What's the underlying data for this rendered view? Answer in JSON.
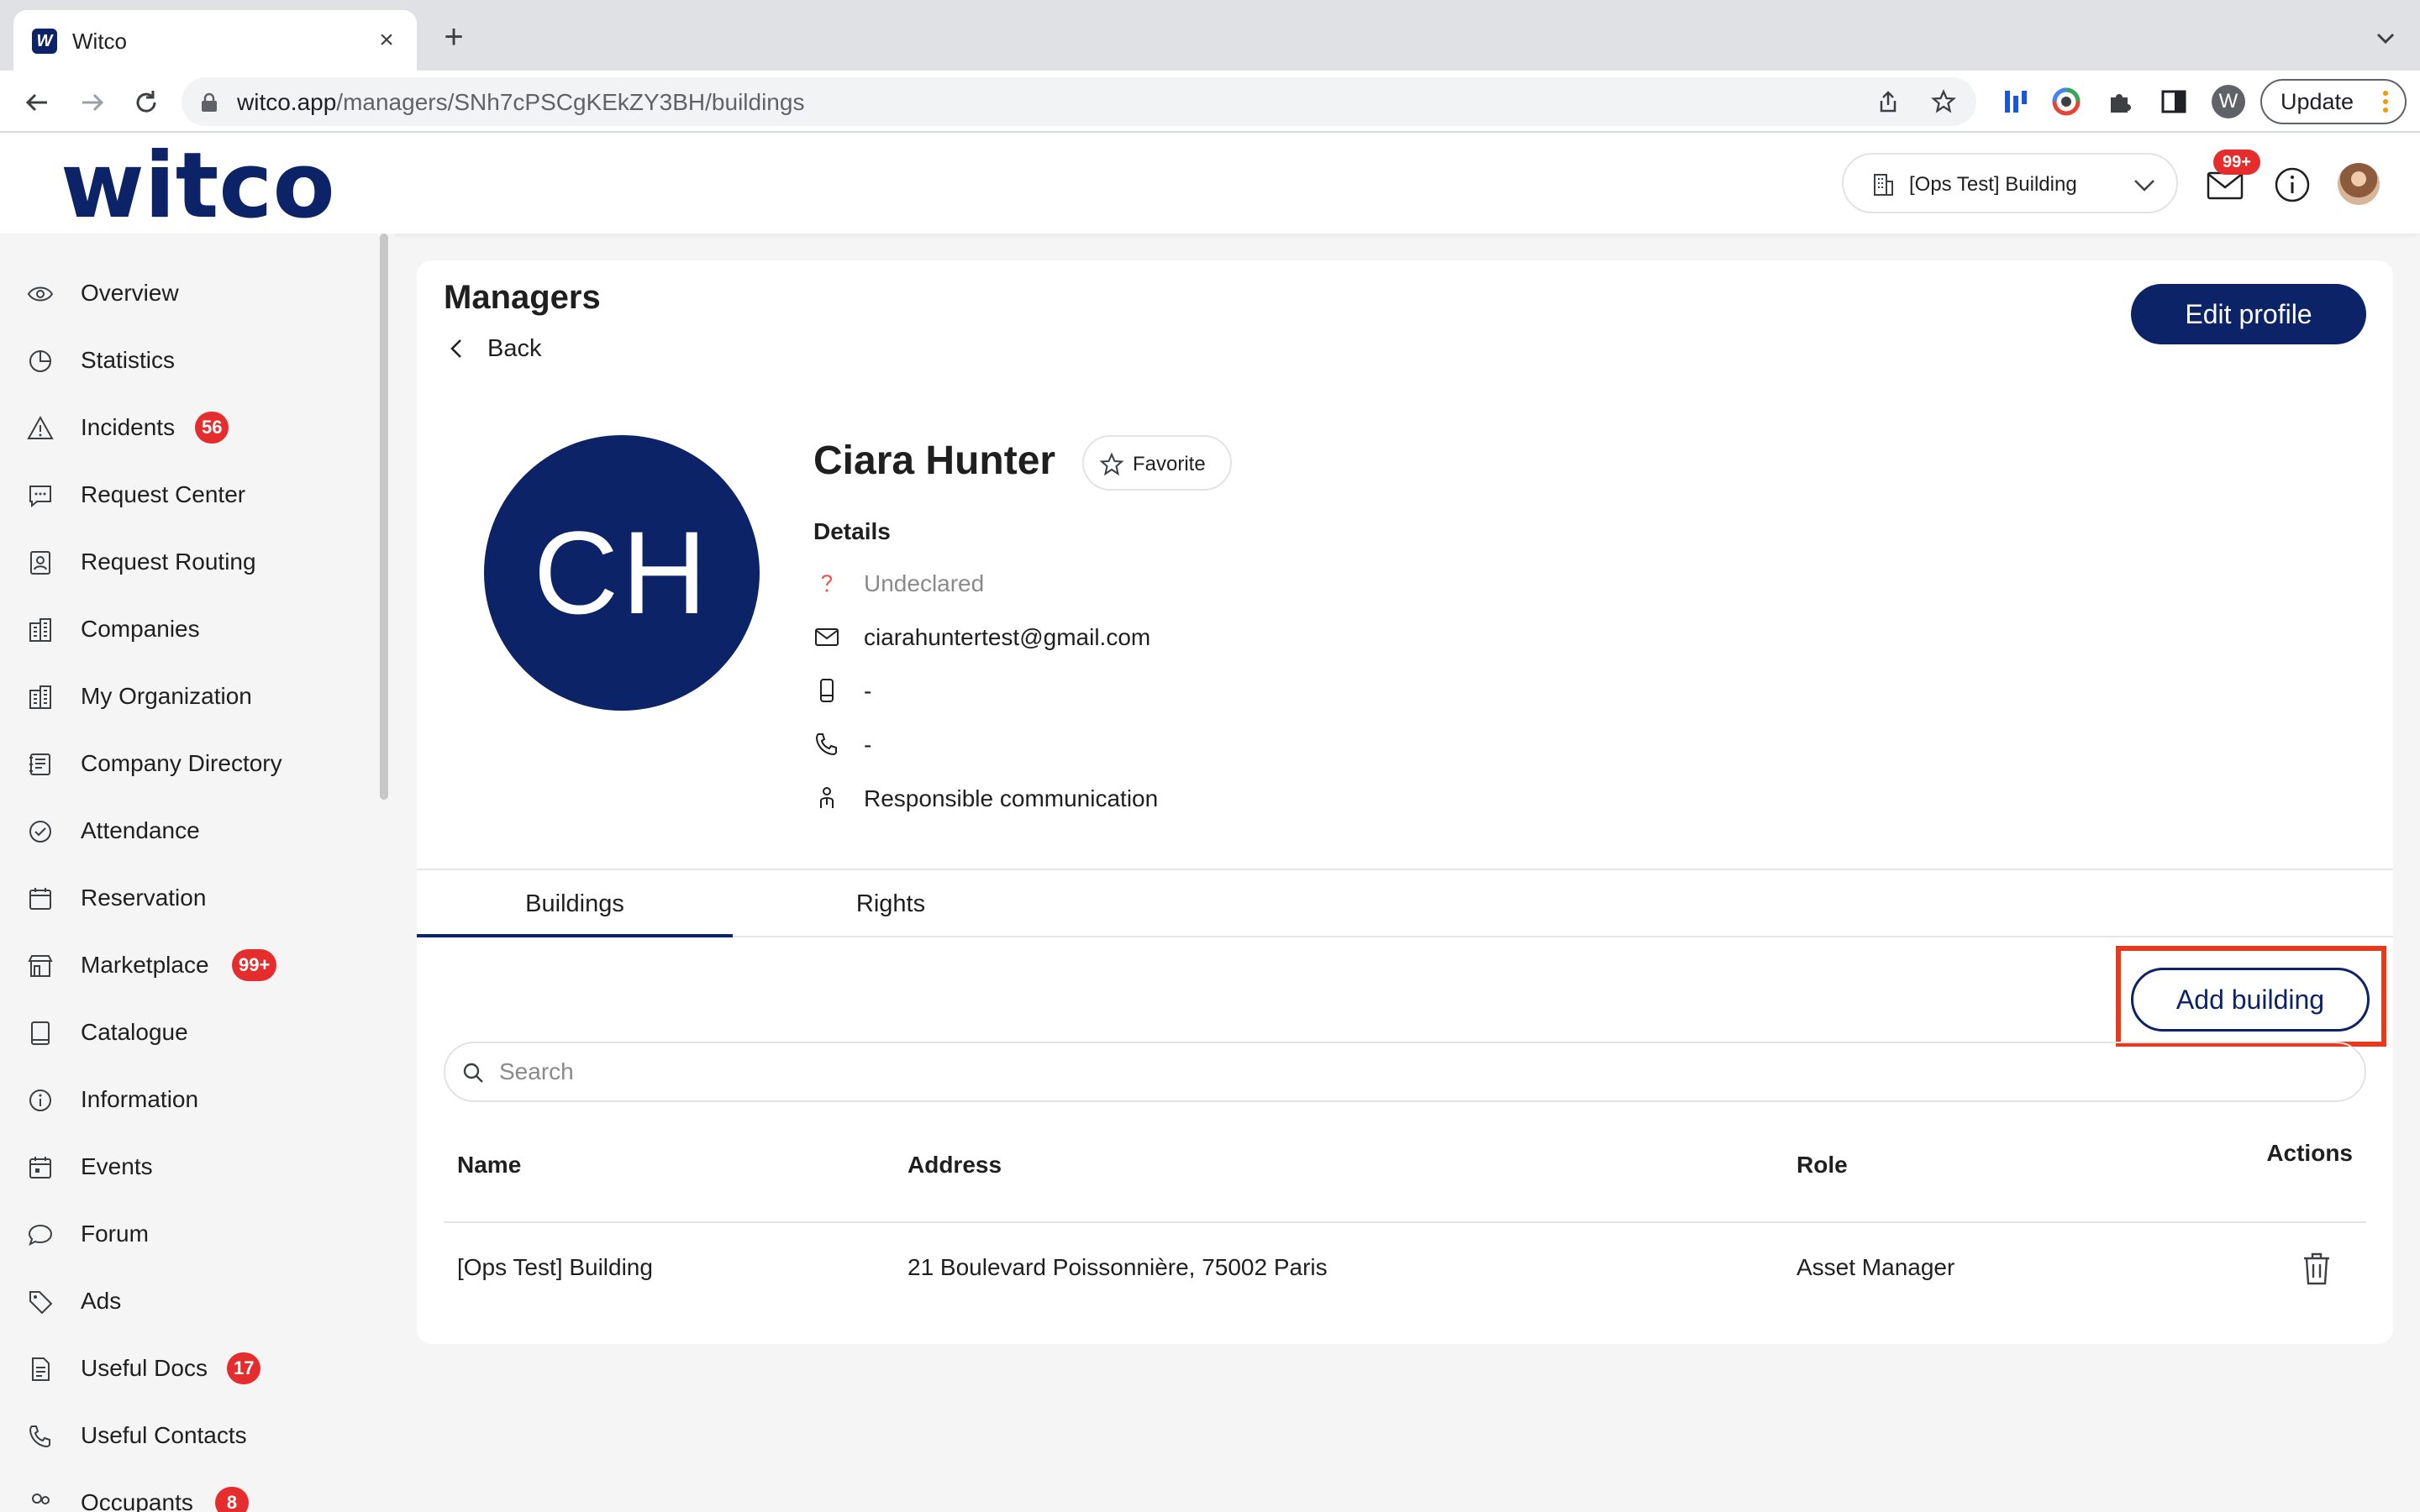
{
  "browser": {
    "tab_title": "Witco",
    "favicon_letter": "W",
    "url_host": "witco.app",
    "url_path": "/managers/SNh7cPSCgKEkZY3BH/buildings",
    "profile_letter": "W",
    "update_label": "Update"
  },
  "header": {
    "logo": "witco",
    "building_select": "[Ops Test] Building",
    "mail_badge": "99+"
  },
  "sidebar": {
    "items": [
      {
        "label": "Overview",
        "icon": "eye-icon"
      },
      {
        "label": "Statistics",
        "icon": "pie-chart-icon"
      },
      {
        "label": "Incidents",
        "icon": "warning-icon",
        "badge": "56"
      },
      {
        "label": "Request Center",
        "icon": "chat-icon"
      },
      {
        "label": "Request Routing",
        "icon": "contact-card-icon"
      },
      {
        "label": "Companies",
        "icon": "building-icon"
      },
      {
        "label": "My Organization",
        "icon": "building-icon"
      },
      {
        "label": "Company Directory",
        "icon": "directory-icon"
      },
      {
        "label": "Attendance",
        "icon": "check-circle-icon"
      },
      {
        "label": "Reservation",
        "icon": "calendar-icon"
      },
      {
        "label": "Marketplace",
        "icon": "store-icon",
        "badge": "99+"
      },
      {
        "label": "Catalogue",
        "icon": "book-icon"
      },
      {
        "label": "Information",
        "icon": "info-icon"
      },
      {
        "label": "Events",
        "icon": "event-icon"
      },
      {
        "label": "Forum",
        "icon": "speech-bubble-icon"
      },
      {
        "label": "Ads",
        "icon": "tag-icon"
      },
      {
        "label": "Useful Docs",
        "icon": "document-icon",
        "badge": "17"
      },
      {
        "label": "Useful Contacts",
        "icon": "sos-phone-icon"
      },
      {
        "label": "Occupants",
        "icon": "people-icon",
        "badge": "8"
      }
    ]
  },
  "main": {
    "title": "Managers",
    "back_label": "Back",
    "edit_profile_label": "Edit profile",
    "profile": {
      "initials": "CH",
      "name": "Ciara Hunter",
      "favorite_label": "Favorite",
      "details_title": "Details",
      "gender": "Undeclared",
      "email": "ciarahuntertest@gmail.com",
      "mobile": "-",
      "phone": "-",
      "role": "Responsible communication"
    },
    "tabs": [
      "Buildings",
      "Rights"
    ],
    "add_building_label": "Add building",
    "search_placeholder": "Search",
    "table": {
      "headers": [
        "Name",
        "Address",
        "Role",
        "Actions"
      ],
      "rows": [
        {
          "name": "[Ops Test] Building",
          "address": "21 Boulevard Poissonnière, 75002 Paris",
          "role": "Asset Manager"
        }
      ]
    }
  },
  "colors": {
    "brand_navy": "#0d2367",
    "badge_red": "#e52d2d",
    "highlight_red": "#e43b1f"
  }
}
